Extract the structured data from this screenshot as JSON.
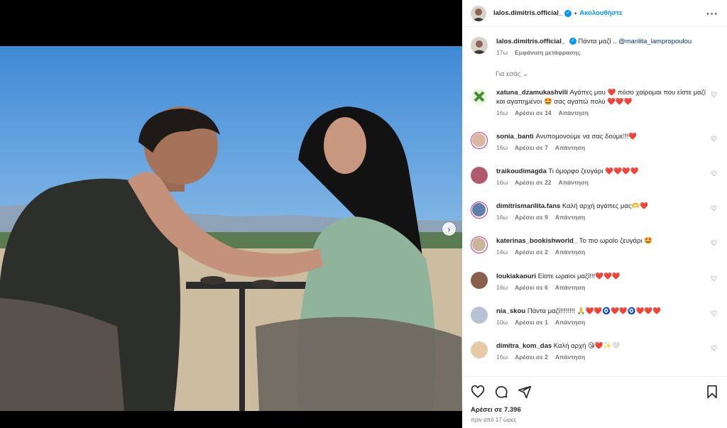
{
  "post": {
    "username": "lalos.dimitris.official_",
    "follow_label": "Ακολουθήστε",
    "caption_text": "Πάντα μαζί ..",
    "caption_mention": "@marilita_lampropoulou",
    "caption_age": "17ω",
    "translate_label": "Εμφάνιση μετάφρασης",
    "for_you_label": "Για εσάς",
    "likes_label": "Αρέσει σε 7.396",
    "time_ago": "πριν από 17 ώρες"
  },
  "comments": [
    {
      "user": "xatuna_dzamukashvili",
      "text": "Αγάπες μου ❤️ πόσο χαίρομαι που είστε μαζί και αγαπημένοι 🤩 σας αγαπώ πολύ ❤️❤️❤️",
      "age": "16ω",
      "likes": "Αρέσει σε 14",
      "reply": "Απάντηση"
    },
    {
      "user": "sonia_banti",
      "text": "Ανυπομονούμε να σας δούμε!!!❤️",
      "age": "16ω",
      "likes": "Αρέσει σε 7",
      "reply": "Απάντηση"
    },
    {
      "user": "traikoudimagda",
      "text": "Τι όμορφο ζευγάρι ❤️❤️❤️❤️",
      "age": "16ω",
      "likes": "Αρέσει σε 22",
      "reply": "Απάντηση"
    },
    {
      "user": "dimitrismarilita.fans",
      "text": "Καλή αρχή αγάπες μας🫶❤️",
      "age": "16ω",
      "likes": "Αρέσει σε 9",
      "reply": "Απάντηση"
    },
    {
      "user": "katerinas_bookishworld_",
      "text": "Το πιο ωραίο ζευγάρι 🤩",
      "age": "14ω",
      "likes": "Αρέσει σε 2",
      "reply": "Απάντηση"
    },
    {
      "user": "loukiakaouri",
      "text": "Είστε ωραίοι μαζί!!!❤️❤️❤️",
      "age": "16ω",
      "likes": "Αρέσει σε 6",
      "reply": "Απάντηση"
    },
    {
      "user": "nia_skou",
      "text": "Πάντα μαζί!!!!!!!! 🙏❤️❤️🧿❤️❤️🧿❤️❤️❤️",
      "age": "10ω",
      "likes": "Αρέσει σε 1",
      "reply": "Απάντηση"
    },
    {
      "user": "dimitra_kom_das",
      "text": "Καλή αρχή 😘❤️✨🤍",
      "age": "16ω",
      "likes": "Αρέσει σε 2",
      "reply": "Απάντηση"
    }
  ],
  "colors": {
    "accent": "#0095f6",
    "heart": "#ed4956",
    "ring": "#d62976"
  },
  "icons": [
    "verified-badge-icon",
    "more-options-icon",
    "chevron-down-icon",
    "heart-icon",
    "comment-icon",
    "share-icon",
    "bookmark-icon",
    "next-arrow-icon"
  ]
}
